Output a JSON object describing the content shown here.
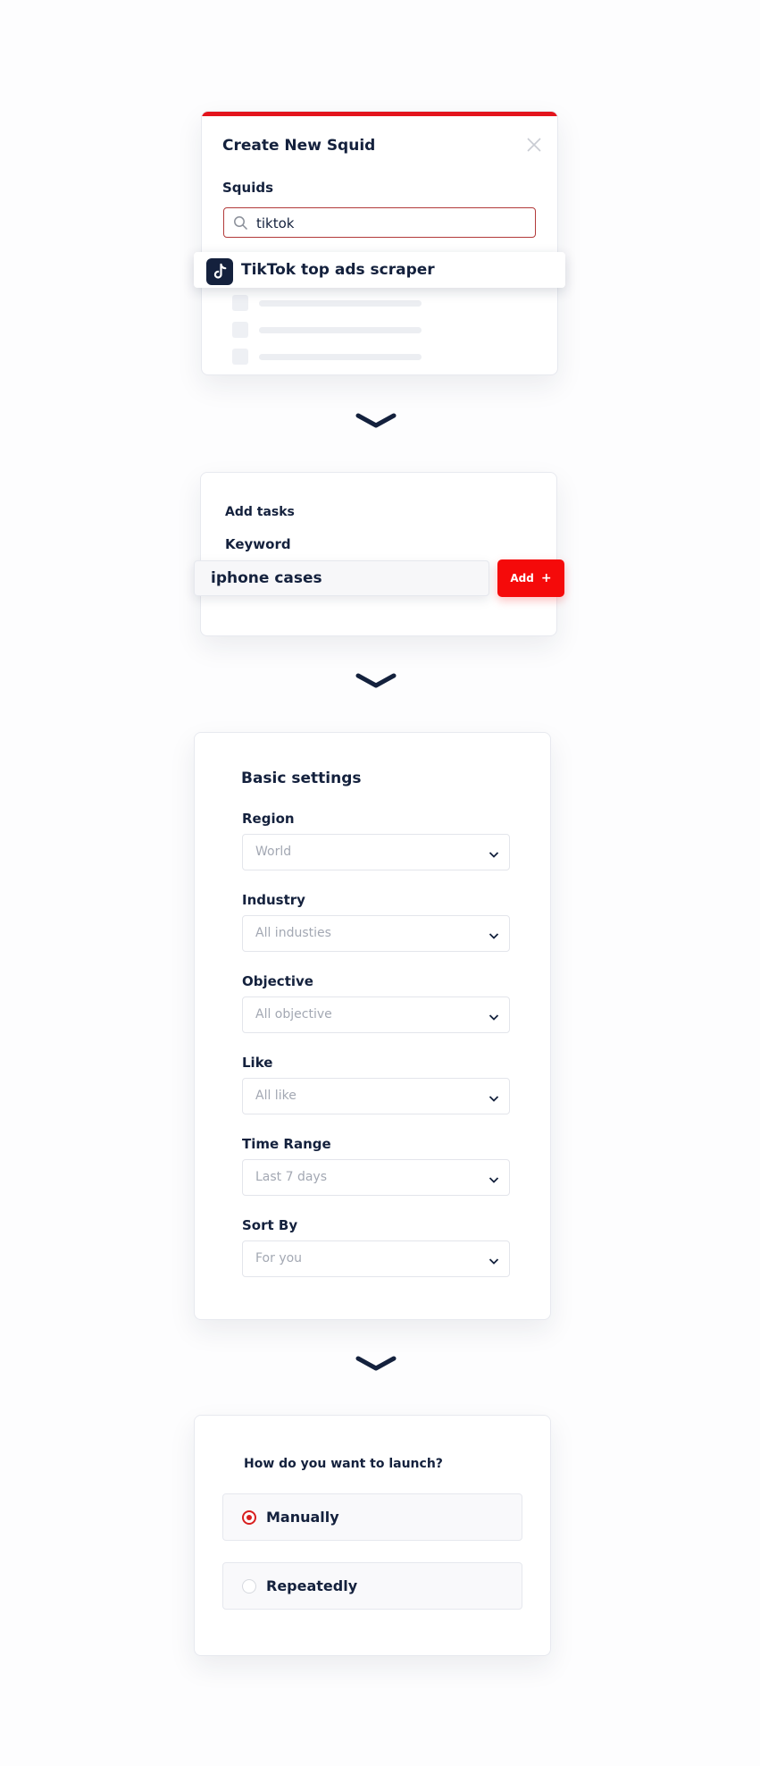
{
  "create_squid": {
    "title": "Create New Squid",
    "squids_label": "Squids",
    "search_value": "tiktok",
    "result": "TikTok top ads scraper"
  },
  "add_tasks": {
    "title": "Add tasks",
    "keyword_label": "Keyword",
    "keyword_value": "iphone cases",
    "add_label": "Add",
    "add_symbol": "+"
  },
  "basic_settings": {
    "title": "Basic settings",
    "fields": [
      {
        "label": "Region",
        "value": "World"
      },
      {
        "label": "Industry",
        "value": "All industies"
      },
      {
        "label": "Objective",
        "value": "All objective"
      },
      {
        "label": "Like",
        "value": "All like"
      },
      {
        "label": "Time Range",
        "value": "Last 7 days"
      },
      {
        "label": "Sort By",
        "value": "For you"
      }
    ]
  },
  "launch": {
    "question": "How do you want to launch?",
    "options": [
      {
        "label": "Manually",
        "selected": true
      },
      {
        "label": "Repeatedly",
        "selected": false
      }
    ]
  },
  "colors": {
    "accent": "#e3141c",
    "button": "#f50a0a",
    "text": "#14213d"
  },
  "icons": [
    "close-icon",
    "search-icon",
    "tiktok-icon",
    "chevron-down-icon",
    "plus-icon"
  ]
}
